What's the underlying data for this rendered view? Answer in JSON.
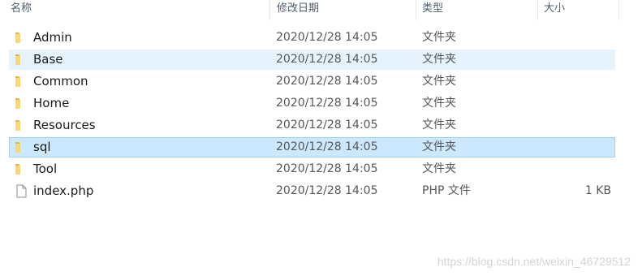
{
  "columns": {
    "name": "名称",
    "date": "修改日期",
    "type": "类型",
    "size": "大小"
  },
  "files": [
    {
      "name": "Admin",
      "date": "2020/12/28 14:05",
      "type": "文件夹",
      "size": "",
      "icon": "folder-icon"
    },
    {
      "name": "Base",
      "date": "2020/12/28 14:05",
      "type": "文件夹",
      "size": "",
      "icon": "folder-icon",
      "state": "hover"
    },
    {
      "name": "Common",
      "date": "2020/12/28 14:05",
      "type": "文件夹",
      "size": "",
      "icon": "folder-icon"
    },
    {
      "name": "Home",
      "date": "2020/12/28 14:05",
      "type": "文件夹",
      "size": "",
      "icon": "folder-icon"
    },
    {
      "name": "Resources",
      "date": "2020/12/28 14:05",
      "type": "文件夹",
      "size": "",
      "icon": "folder-icon"
    },
    {
      "name": "sql",
      "date": "2020/12/28 14:05",
      "type": "文件夹",
      "size": "",
      "icon": "folder-icon",
      "state": "selected"
    },
    {
      "name": "Tool",
      "date": "2020/12/28 14:05",
      "type": "文件夹",
      "size": "",
      "icon": "folder-icon"
    },
    {
      "name": "index.php",
      "date": "2020/12/28 14:05",
      "type": "PHP 文件",
      "size": "1 KB",
      "icon": "file-icon"
    }
  ],
  "colors": {
    "folder": "#f8d775",
    "folder_dark": "#e0b84a",
    "hover_bg": "#e5f3ff",
    "selected_bg": "#cce8ff",
    "selected_border": "#99d1ff"
  },
  "watermark": "https://blog.csdn.net/weixin_46729512"
}
